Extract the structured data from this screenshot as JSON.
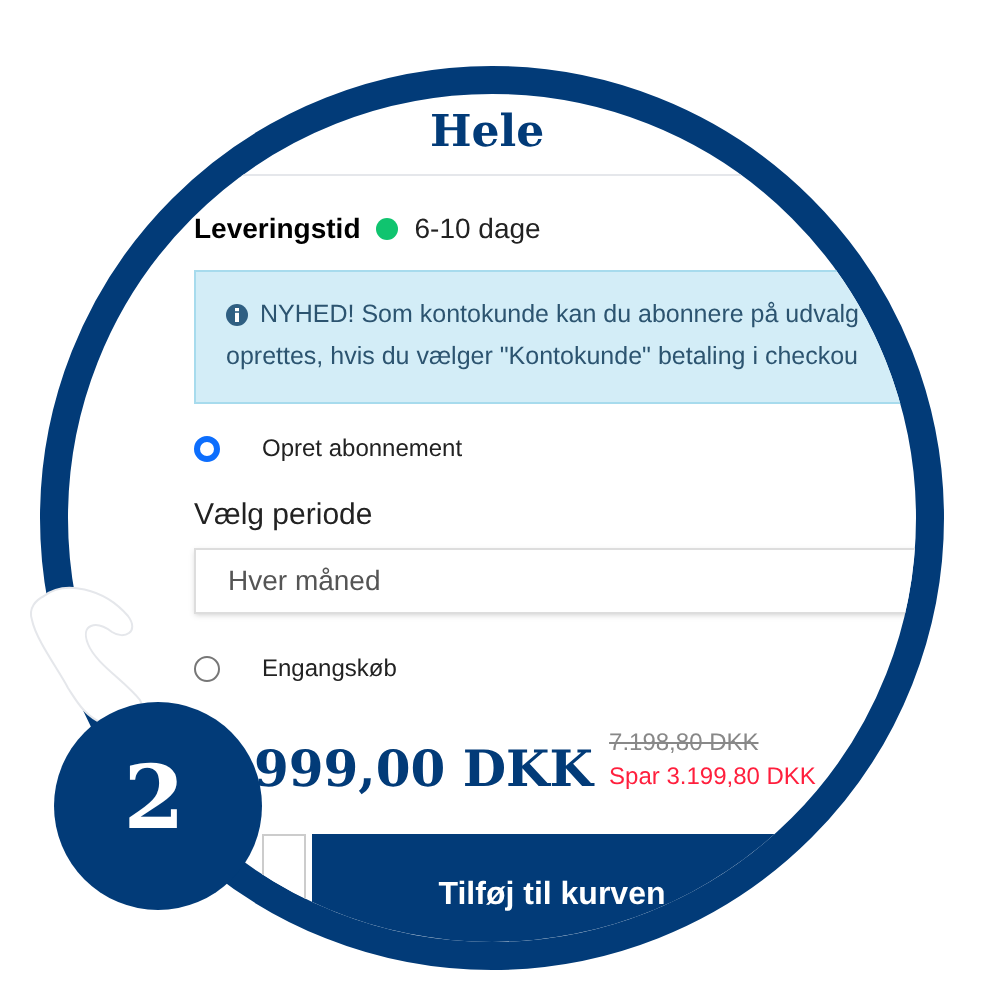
{
  "heading": "Hele",
  "delivery": {
    "label": "Leveringstid",
    "value": "6-10 dage"
  },
  "notice": {
    "lines": [
      "NYHED! Som kontokunde kan du abonnere på udvalg",
      "oprettes, hvis du vælger \"Kontokunde\" betaling i checkou"
    ]
  },
  "options": [
    {
      "label": "Opret abonnement",
      "selected": true
    },
    {
      "label": "Engangskøb",
      "selected": false
    }
  ],
  "period": {
    "label": "Vælg periode",
    "value": "Hver måned"
  },
  "price": {
    "current": "999,00 DKK",
    "original": "7.198,80 DKK",
    "saving": "Spar 3.199,80 DKK"
  },
  "add_to_cart": "Tilføj til kurven",
  "step": "2"
}
